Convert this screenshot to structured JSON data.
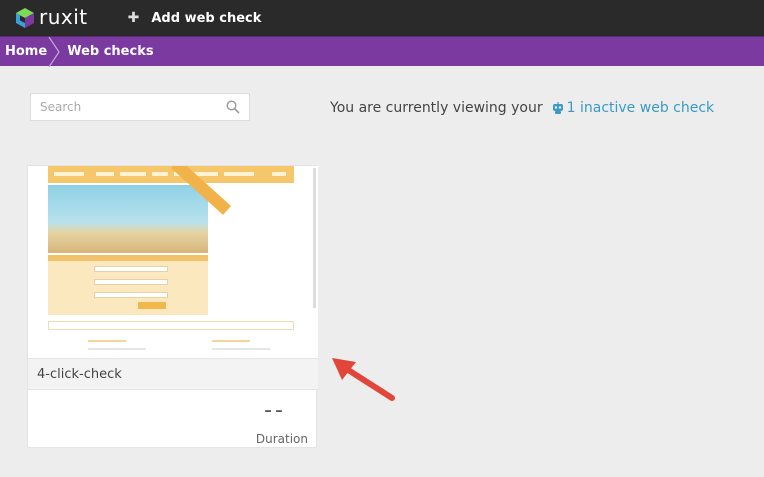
{
  "app": {
    "brand": "ruxit"
  },
  "topbar": {
    "add_label": "Add web check"
  },
  "breadcrumb": {
    "home": "Home",
    "current": "Web checks"
  },
  "search": {
    "placeholder": "Search"
  },
  "viewing": {
    "prefix": "You are currently viewing your",
    "link": "1 inactive web check"
  },
  "card": {
    "name": "4-click-check",
    "metric_value": "--",
    "metric_label": "Duration"
  },
  "colors": {
    "topbar": "#2a2a2a",
    "breadcrumb": "#7a3aa0",
    "link": "#3a9ac6",
    "arrow": "#e2463a"
  }
}
